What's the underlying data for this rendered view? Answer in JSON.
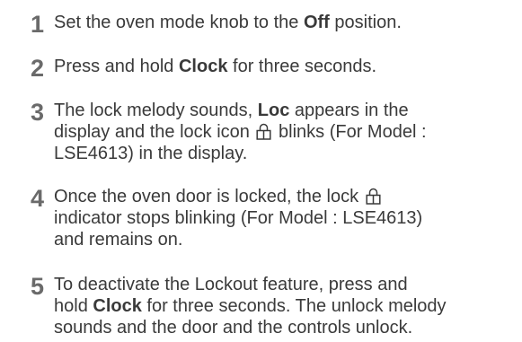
{
  "steps": [
    {
      "number": "1",
      "lines": [
        [
          {
            "text": "Set the oven mode knob to the "
          },
          {
            "text": "Off",
            "bold": true
          },
          {
            "text": " position."
          }
        ]
      ]
    },
    {
      "number": "2",
      "lines": [
        [
          {
            "text": "Press and hold "
          },
          {
            "text": "Clock",
            "bold": true
          },
          {
            "text": " for three seconds."
          }
        ]
      ]
    },
    {
      "number": "3",
      "lines": [
        [
          {
            "text": "The lock melody sounds, "
          },
          {
            "text": "Loc",
            "bold": true
          },
          {
            "text": " appears in the"
          }
        ],
        [
          {
            "text": "display and the lock icon "
          },
          {
            "icon": "lock-icon"
          },
          {
            "text": " blinks (For Model :"
          }
        ],
        [
          {
            "text": "LSE4613) in the display."
          }
        ]
      ]
    },
    {
      "number": "4",
      "lines": [
        [
          {
            "text": "Once the oven door is locked, the lock "
          },
          {
            "icon": "lock-icon"
          }
        ],
        [
          {
            "text": "indicator stops blinking (For Model : LSE4613)"
          }
        ],
        [
          {
            "text": "and remains on."
          }
        ]
      ]
    },
    {
      "number": "5",
      "lines": [
        [
          {
            "text": "To deactivate the Lockout feature, press and"
          }
        ],
        [
          {
            "text": "hold "
          },
          {
            "text": "Clock",
            "bold": true
          },
          {
            "text": " for three seconds. The unlock melody"
          }
        ],
        [
          {
            "text": "sounds and the door and the controls unlock."
          }
        ]
      ]
    }
  ]
}
